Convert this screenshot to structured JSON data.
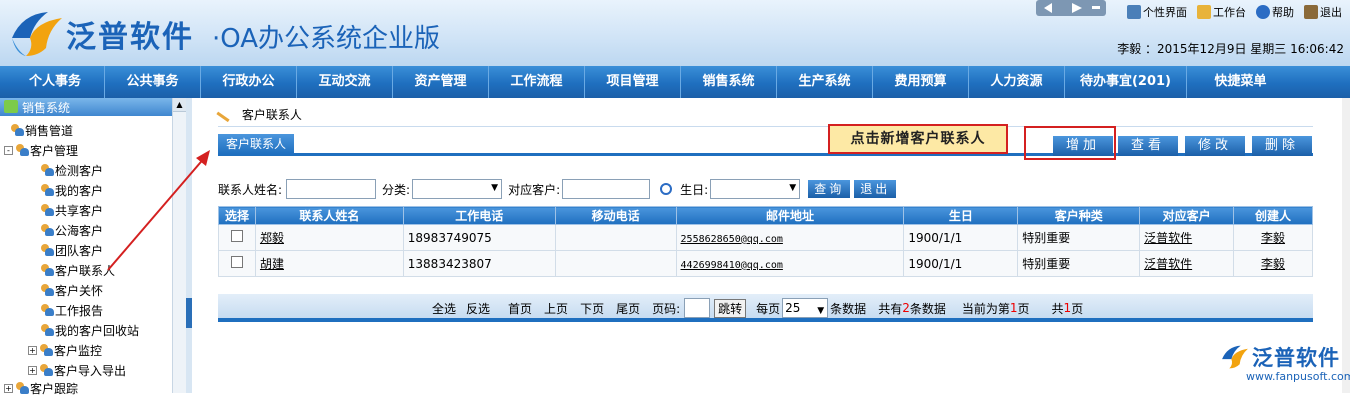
{
  "header": {
    "logo_text": "泛普软件",
    "logo_subtitle": "·OA办公系统企业版",
    "tools": [
      {
        "label": "个性界面",
        "icon": "monitor-icon"
      },
      {
        "label": "工作台",
        "icon": "folder-icon"
      },
      {
        "label": "帮助",
        "icon": "help-icon"
      },
      {
        "label": "退出",
        "icon": "exit-icon"
      }
    ],
    "user_line": "李毅 ：2015年12月9日 星期三 16:06:42"
  },
  "nav": [
    "个人事务",
    "公共事务",
    "行政办公",
    "互动交流",
    "资产管理",
    "工作流程",
    "项目管理",
    "销售系统",
    "生产系统",
    "费用预算",
    "人力资源",
    "待办事宜(201)",
    "快捷菜单"
  ],
  "sidebar": {
    "title": "销售系统",
    "items": [
      {
        "label": "销售管道",
        "level": 0,
        "toggle": ""
      },
      {
        "label": "客户管理",
        "level": 0,
        "toggle": "-"
      },
      {
        "label": "检测客户",
        "level": 1,
        "toggle": ""
      },
      {
        "label": "我的客户",
        "level": 1,
        "toggle": ""
      },
      {
        "label": "共享客户",
        "level": 1,
        "toggle": ""
      },
      {
        "label": "公海客户",
        "level": 1,
        "toggle": ""
      },
      {
        "label": "团队客户",
        "level": 1,
        "toggle": ""
      },
      {
        "label": "客户联系人",
        "level": 1,
        "toggle": ""
      },
      {
        "label": "客户关怀",
        "level": 1,
        "toggle": ""
      },
      {
        "label": "工作报告",
        "level": 1,
        "toggle": ""
      },
      {
        "label": "我的客户回收站",
        "level": 1,
        "toggle": ""
      },
      {
        "label": "客户监控",
        "level": 1,
        "toggle": "+"
      },
      {
        "label": "客户导入导出",
        "level": 1,
        "toggle": "+"
      },
      {
        "label": "客户跟踪",
        "level": 0,
        "toggle": "+"
      }
    ]
  },
  "main": {
    "breadcrumb": "客户联系人",
    "section_tab": "客户联系人",
    "callout": "点击新增客户联系人",
    "actions": {
      "add": "增加",
      "view": "查看",
      "edit": "修改",
      "delete": "删除"
    },
    "filter": {
      "name_label": "联系人姓名:",
      "category_label": "分类:",
      "customer_label": "对应客户:",
      "birthday_label": "生日:",
      "query_btn": "查询",
      "exit_btn": "退出"
    },
    "table": {
      "headers": [
        "选择",
        "联系人姓名",
        "工作电话",
        "移动电话",
        "邮件地址",
        "生日",
        "客户种类",
        "对应客户",
        "创建人"
      ],
      "rows": [
        {
          "name": "郑毅",
          "work_phone": "18983749075",
          "mobile": "",
          "email": "2558628650@qq.com",
          "birthday": "1900/1/1",
          "kind": "特别重要",
          "customer": "泛普软件",
          "creator": "李毅"
        },
        {
          "name": "胡建",
          "work_phone": "13883423807",
          "mobile": "",
          "email": "4426998410@qq.com",
          "birthday": "1900/1/1",
          "kind": "特别重要",
          "customer": "泛普软件",
          "creator": "李毅"
        }
      ]
    },
    "pager": {
      "select_all": "全选",
      "invert": "反选",
      "first": "首页",
      "prev": "上页",
      "next": "下页",
      "last": "尾页",
      "page_label": "页码:",
      "jump": "跳转",
      "per_page_label": "每页",
      "per_page": "25",
      "per_page_suffix": "条数据",
      "total_prefix": "共有",
      "total": "2",
      "total_suffix": "条数据",
      "current_prefix": "当前为第",
      "current": "1",
      "current_suffix": "页",
      "pages_prefix": "共",
      "pages": "1",
      "pages_suffix": "页"
    }
  },
  "watermark": {
    "text": "泛普软件",
    "url": "www.fanpusoft.com"
  },
  "colors": {
    "brand": "#1b63b8",
    "nav": "#1f6fbf",
    "highlight": "#d42020",
    "callout_bg": "#fde9a5"
  }
}
